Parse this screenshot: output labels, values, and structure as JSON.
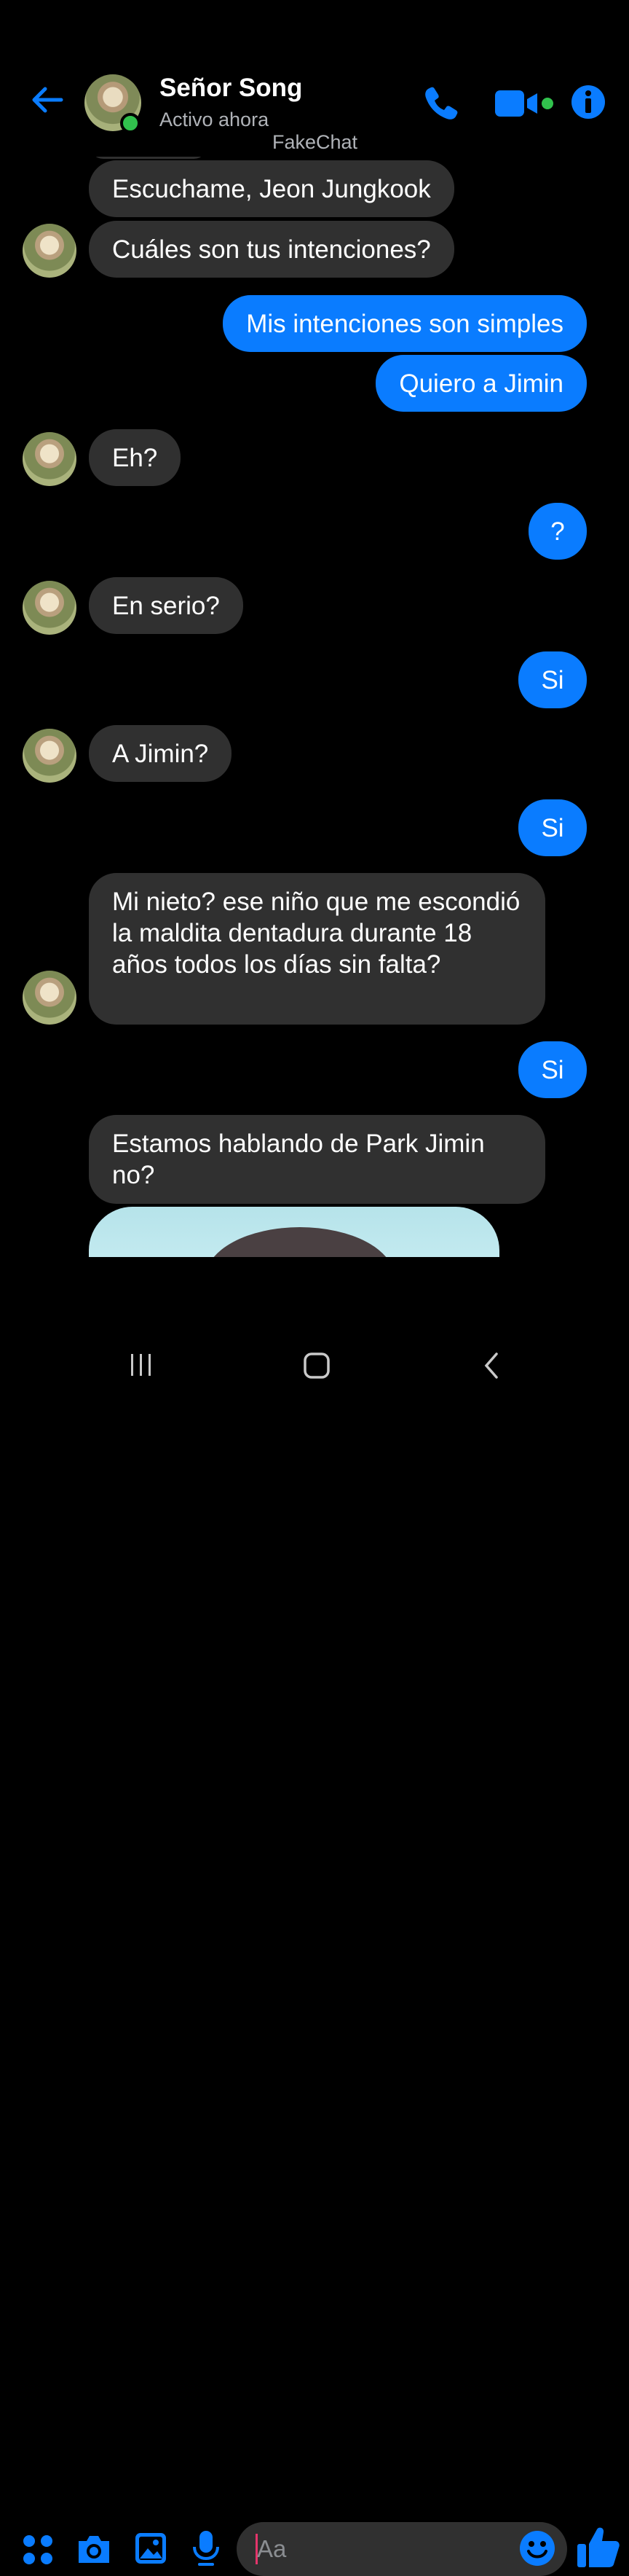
{
  "header": {
    "contact_name": "Señor Song",
    "status": "Activo ahora",
    "watermark": "FakeChat",
    "icons": [
      "back-arrow-icon",
      "phone-icon",
      "video-camera-icon",
      "info-icon"
    ]
  },
  "messages": [
    {
      "from": "them",
      "text": "Escuchame, Jeon Jungkook"
    },
    {
      "from": "them",
      "text": "Cuáles son tus intenciones?"
    },
    {
      "from": "me",
      "text": "Mis intenciones son simples"
    },
    {
      "from": "me",
      "text": "Quiero a Jimin"
    },
    {
      "from": "them",
      "text": "Eh?"
    },
    {
      "from": "me",
      "text": "?"
    },
    {
      "from": "them",
      "text": "En serio?"
    },
    {
      "from": "me",
      "text": "Si"
    },
    {
      "from": "them",
      "text": "A Jimin?"
    },
    {
      "from": "me",
      "text": "Si"
    },
    {
      "from": "them",
      "text": "Mi nieto? ese niño que me escondió la maldita dentadura durante 18 años todos los días sin falta?"
    },
    {
      "from": "me",
      "text": "Si"
    },
    {
      "from": "them",
      "text": "Estamos hablando de Park Jimin no?"
    }
  ],
  "composer": {
    "placeholder": "Aa",
    "icons": [
      "apps-grid-icon",
      "camera-icon",
      "gallery-icon",
      "microphone-icon",
      "emoji-icon",
      "thumbs-up-icon"
    ]
  },
  "colors": {
    "accent": "#0a7cff",
    "incoming_bubble": "#303030",
    "background": "#000000",
    "online": "#31c24d"
  }
}
